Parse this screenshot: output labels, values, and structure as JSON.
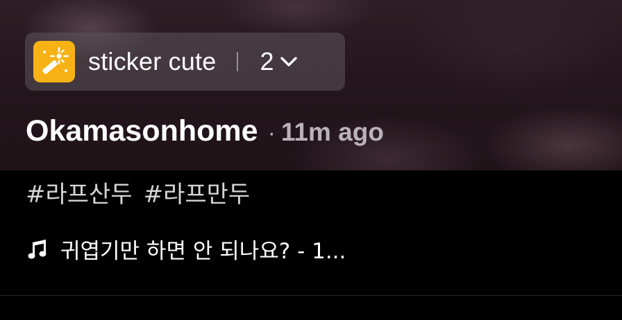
{
  "sticker_chip": {
    "label": "sticker cute",
    "count": "2",
    "badge_icon": "magic-wand-sparkle-icon",
    "badge_color": "#f7b215",
    "chevron_icon": "chevron-down-icon"
  },
  "post": {
    "username": "Okamasonhome",
    "separator": "·",
    "time_ago": "11m ago"
  },
  "hashtags": [
    "#라프산두",
    "#라프만두"
  ],
  "music": {
    "icon": "music-note-icon",
    "title": "귀엽기만 하면 안 되나요? - 1..."
  }
}
